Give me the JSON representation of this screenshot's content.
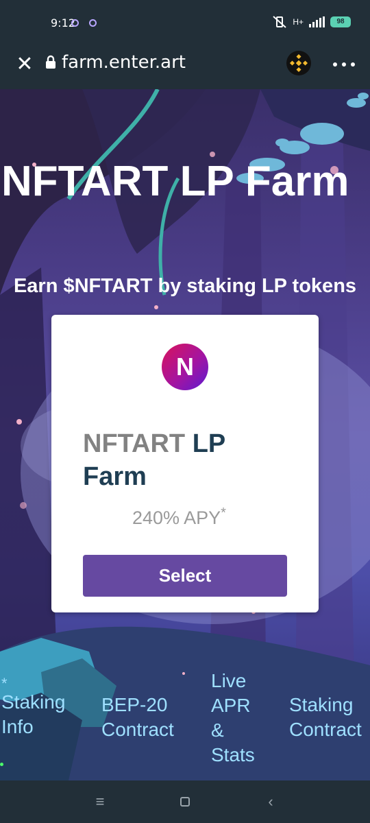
{
  "status_bar": {
    "time": "9:12",
    "battery": "98",
    "network": "H+"
  },
  "browser": {
    "url": "farm.enter.art"
  },
  "hero": {
    "title": "NFTART LP Farm",
    "subtitle": "Earn $NFTART by staking LP tokens"
  },
  "card": {
    "logo_letter": "N",
    "title_part1": "NFTART",
    "title_part2": "LP",
    "title_part3": "Farm",
    "apy": "240% APY",
    "apy_mark": "*",
    "select_label": "Select"
  },
  "footer_links": [
    {
      "label": "Staking Info",
      "prefix": "*"
    },
    {
      "label": "BEP-20 Contract"
    },
    {
      "label": "Live APR & Stats"
    },
    {
      "label": "Staking Contract"
    }
  ],
  "icons": {
    "close": "close-icon",
    "lock": "lock-icon",
    "bnb": "bnb-icon",
    "more": "more-icon",
    "recent_apps": "menu-icon",
    "home": "square-icon",
    "back": "chevron-left-icon"
  }
}
